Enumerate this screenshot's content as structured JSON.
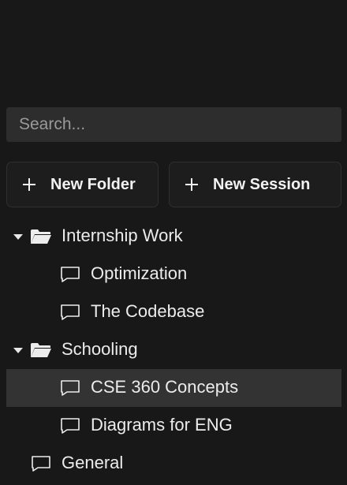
{
  "search": {
    "placeholder": "Search..."
  },
  "actions": {
    "new_folder": "New Folder",
    "new_session": "New Session"
  },
  "tree": {
    "folders": [
      {
        "label": "Internship Work",
        "expanded": true,
        "sessions": [
          "Optimization",
          "The Codebase"
        ]
      },
      {
        "label": "Schooling",
        "expanded": true,
        "sessions": [
          "CSE 360 Concepts",
          "Diagrams for ENG"
        ],
        "selected_session": "CSE 360 Concepts"
      }
    ],
    "root_sessions": [
      "General"
    ]
  },
  "colors": {
    "background": "#181818",
    "search_bg": "#2d2d2d",
    "selected_row": "#333333",
    "button_border": "#2f2f2f"
  },
  "icons": {
    "folder": "folder-open-icon",
    "session": "chat-bubble-icon",
    "expand": "caret-down-icon",
    "add": "plus-icon"
  }
}
